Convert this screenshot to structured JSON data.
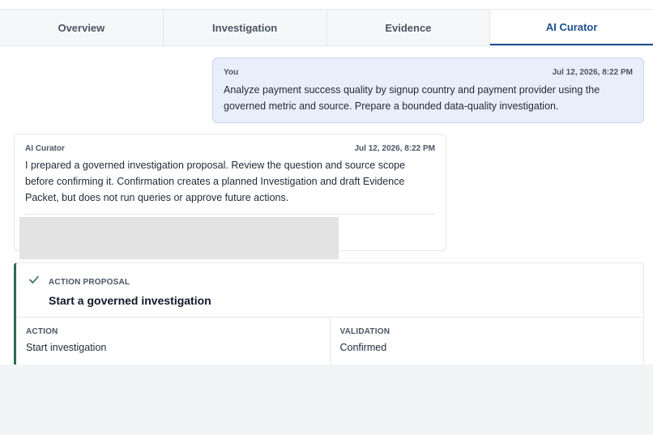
{
  "tabs": [
    {
      "label": "Overview",
      "active": false
    },
    {
      "label": "Investigation",
      "active": false
    },
    {
      "label": "Evidence",
      "active": false
    },
    {
      "label": "AI Curator",
      "active": true
    }
  ],
  "messages": {
    "user": {
      "author": "You",
      "timestamp": "Jul 12, 2026, 8:22 PM",
      "lines": [
        "Analyze payment success quality by signup country and payment provider using the",
        "governed metric and source. Prepare a bounded data-quality investigation."
      ]
    },
    "ai": {
      "author": "AI Curator",
      "timestamp": "Jul 12, 2026, 8:22 PM",
      "lines": [
        "I prepared a governed investigation proposal. Review the question and source scope",
        "before confirming it. Confirmation creates a planned Investigation and draft Evidence",
        "Packet, but does not run queries or approve future actions."
      ]
    }
  },
  "proposal": {
    "icon": "check-icon",
    "kicker": "ACTION PROPOSAL",
    "title": "Start a governed investigation",
    "action_label": "ACTION",
    "action_value": "Start investigation",
    "validation_label": "VALIDATION",
    "validation_value": "Confirmed"
  },
  "colors": {
    "accent": "#1d4f91",
    "user_bubble": "#e8eefa",
    "proposal_border": "#2f6b4f"
  }
}
